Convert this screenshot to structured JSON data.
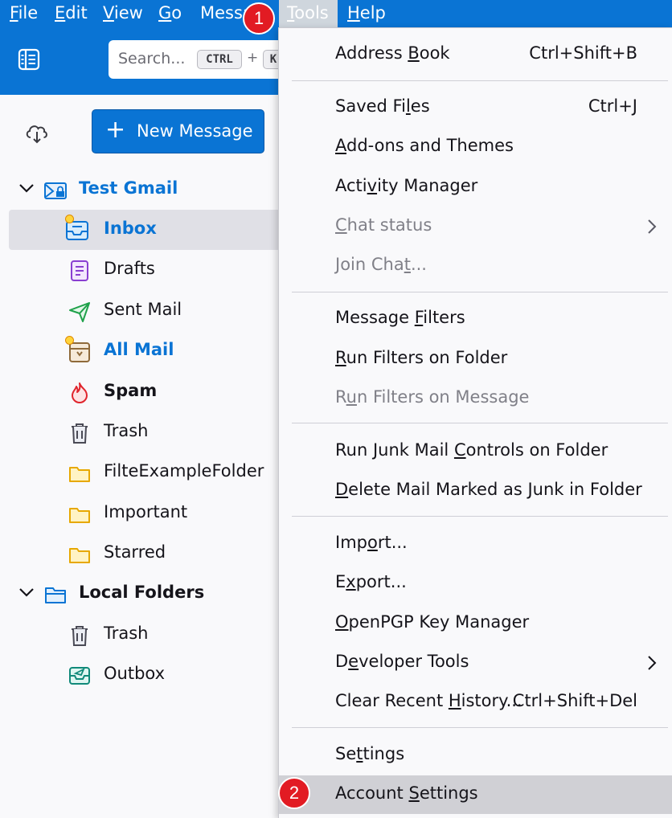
{
  "menubar": {
    "items": [
      {
        "label": "File",
        "accel": "F",
        "rest": "ile"
      },
      {
        "label": "Edit",
        "accel": "E",
        "rest": "dit"
      },
      {
        "label": "View",
        "accel": "V",
        "rest": "iew"
      },
      {
        "label": "Go",
        "accel": "G",
        "rest": "o"
      },
      {
        "label": "Message",
        "visible": "Messa"
      },
      {
        "label": "Tools",
        "accel": "T",
        "rest": "ools"
      },
      {
        "label": "Help",
        "accel": "H",
        "rest": "elp"
      }
    ]
  },
  "toolbar": {
    "search_placeholder": "Search...",
    "kbd1": "CTRL",
    "kbd_plus": "+",
    "kbd2": "K"
  },
  "sidebar": {
    "new_message_label": "New Message",
    "new_message_plus": "+",
    "folders": [
      {
        "label": "Test Gmail",
        "icon": "account-mail-icon"
      },
      {
        "label": "Inbox",
        "icon": "inbox-icon",
        "selected": true
      },
      {
        "label": "Drafts",
        "icon": "drafts-icon"
      },
      {
        "label": "Sent Mail",
        "icon": "sent-icon"
      },
      {
        "label": "All Mail",
        "icon": "archive-icon"
      },
      {
        "label": "Spam",
        "icon": "spam-icon"
      },
      {
        "label": "Trash",
        "icon": "trash-icon"
      },
      {
        "label": "FilteExampleFolder",
        "icon": "folder-icon"
      },
      {
        "label": "Important",
        "icon": "folder-icon"
      },
      {
        "label": "Starred",
        "icon": "folder-icon"
      },
      {
        "label": "Local Folders",
        "icon": "local-folder-icon"
      },
      {
        "label": "Trash",
        "icon": "trash-icon"
      },
      {
        "label": "Outbox",
        "icon": "outbox-icon"
      }
    ]
  },
  "tools_menu": {
    "address_book": {
      "pre": "Address ",
      "u": "B",
      "post": "ook",
      "shortcut": "Ctrl+Shift+B"
    },
    "saved_files": {
      "pre": "Saved Fi",
      "u": "l",
      "post": "es",
      "shortcut": "Ctrl+J"
    },
    "addons": {
      "pre": "",
      "u": "A",
      "post": "dd-ons and Themes"
    },
    "activity": {
      "pre": "Acti",
      "u": "v",
      "post": "ity Manager"
    },
    "chat_status": {
      "pre": "",
      "u": "C",
      "post": "hat status"
    },
    "join_chat": {
      "pre": "Join Cha",
      "u": "t",
      "post": "..."
    },
    "message_filters": {
      "pre": "Message ",
      "u": "F",
      "post": "ilters"
    },
    "run_filters_folder": {
      "pre": "",
      "u": "R",
      "post": "un Filters on Folder"
    },
    "run_filters_message": {
      "pre": "R",
      "u": "u",
      "post": "n Filters on Message"
    },
    "run_junk": {
      "pre": "Run Junk Mail ",
      "u": "C",
      "post": "ontrols on Folder"
    },
    "delete_junk": {
      "pre": "",
      "u": "D",
      "post": "elete Mail Marked as Junk in Folder"
    },
    "import": {
      "pre": "Imp",
      "u": "o",
      "post": "rt..."
    },
    "export": {
      "pre": "E",
      "u": "x",
      "post": "port..."
    },
    "openpgp": {
      "pre": "",
      "u": "O",
      "post": "penPGP Key Manager"
    },
    "developer": {
      "pre": "D",
      "u": "e",
      "post": "veloper Tools"
    },
    "clear_history": {
      "pre": "Clear Recent ",
      "u": "H",
      "post": "istory...",
      "shortcut": "Ctrl+Shift+Del"
    },
    "settings": {
      "pre": "Se",
      "u": "t",
      "post": "tings"
    },
    "account_settings": {
      "pre": "Account ",
      "u": "S",
      "post": "ettings"
    }
  },
  "annotations": {
    "badge1": "1",
    "badge2": "2"
  },
  "colors": {
    "accent": "#0a74d4",
    "badge": "#e21b23",
    "selected_row": "#e0e0e6",
    "highlight_menu": "#d0d0d5"
  }
}
